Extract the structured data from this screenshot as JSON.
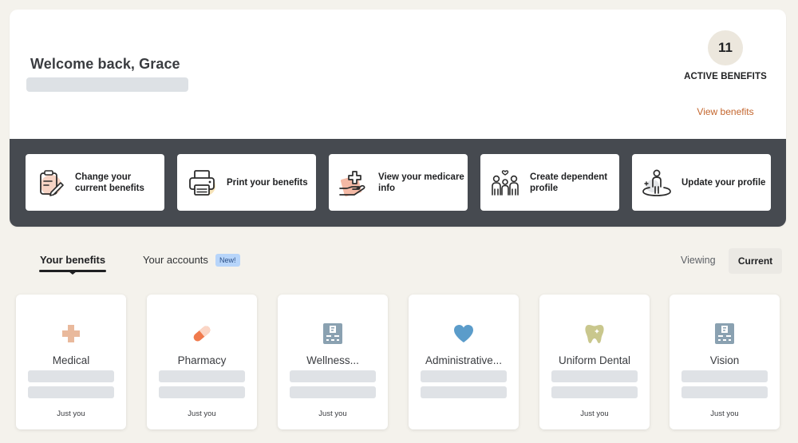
{
  "welcome": {
    "title": "Welcome back, Grace",
    "active_count": "11",
    "active_label": "ACTIVE BENEFITS",
    "view_link": "View benefits"
  },
  "actions": [
    {
      "label": "Change your current benefits",
      "icon": "clipboard-edit-icon"
    },
    {
      "label": "Print your benefits",
      "icon": "printer-icon"
    },
    {
      "label": "View your medicare info",
      "icon": "hand-medical-cross-icon"
    },
    {
      "label": "Create dependent profile",
      "icon": "family-icon"
    },
    {
      "label": "Update your profile",
      "icon": "person-location-icon"
    }
  ],
  "tabs": {
    "benefits": "Your benefits",
    "accounts": "Your accounts",
    "new_badge": "New!",
    "viewing_label": "Viewing",
    "current": "Current"
  },
  "benefits": [
    {
      "title": "Medical",
      "icon": "medical-cross-icon",
      "footer": "Just you"
    },
    {
      "title": "Pharmacy",
      "icon": "pill-icon",
      "footer": "Just you"
    },
    {
      "title": "Wellness...",
      "icon": "eye-chart-icon",
      "footer": "Just you"
    },
    {
      "title": "Administrative...",
      "icon": "heart-icon",
      "footer": ""
    },
    {
      "title": "Uniform Dental",
      "icon": "tooth-icon",
      "footer": "Just you"
    },
    {
      "title": "Vision",
      "icon": "eye-chart-icon",
      "footer": "Just you"
    }
  ],
  "colors": {
    "accent_link": "#c4662e",
    "band": "#464a50",
    "page_bg": "#f4f2ec",
    "skeleton": "#dfe2e6",
    "badge_bg": "#b7d5fa"
  }
}
